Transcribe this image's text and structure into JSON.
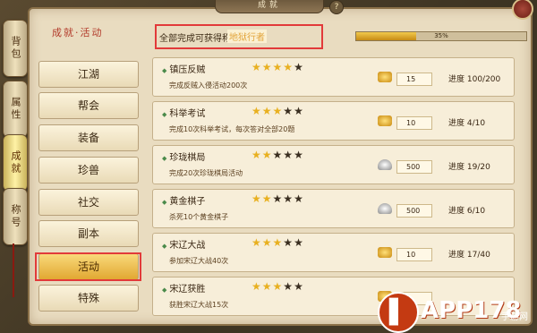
{
  "window": {
    "title": "成就",
    "help": "?"
  },
  "side_tabs": [
    {
      "label": "背包"
    },
    {
      "label": "属性"
    },
    {
      "label": "成就"
    },
    {
      "label": "称号"
    }
  ],
  "heading": "成就·活动",
  "reward": {
    "prefix": "全部完成可获得称号：",
    "title": "地狱行者"
  },
  "overall_progress": {
    "text": "35%",
    "value": 0.35
  },
  "categories": [
    {
      "label": "江湖"
    },
    {
      "label": "帮会"
    },
    {
      "label": "装备"
    },
    {
      "label": "珍兽"
    },
    {
      "label": "社交"
    },
    {
      "label": "副本"
    },
    {
      "label": "活动"
    },
    {
      "label": "特殊"
    }
  ],
  "achievements": [
    {
      "name": "镇压反贼",
      "desc": "完成反贼入侵活动200次",
      "stars": 4,
      "reward_type": "gold-ingot-icon",
      "reward": "15",
      "progress": "进度 100/200"
    },
    {
      "name": "科举考试",
      "desc": "完成10次科举考试，每次答对全部20题",
      "stars": 3,
      "reward_type": "gold-ingot-icon",
      "reward": "10",
      "progress": "进度 4/10"
    },
    {
      "name": "珍珑棋局",
      "desc": "完成20次珍珑棋局活动",
      "stars": 2,
      "reward_type": "silver-ingot-icon",
      "reward": "500",
      "progress": "进度 19/20"
    },
    {
      "name": "黄金棋子",
      "desc": "杀死10个黄金棋子",
      "stars": 2,
      "reward_type": "silver-ingot-icon",
      "reward": "500",
      "progress": "进度 6/10"
    },
    {
      "name": "宋辽大战",
      "desc": "参加宋辽大战40次",
      "stars": 3,
      "reward_type": "gold-ingot-icon",
      "reward": "10",
      "progress": "进度 17/40"
    },
    {
      "name": "宋辽获胜",
      "desc": "获胜宋辽大战15次",
      "stars": 3,
      "reward_type": "gold-ingot-icon",
      "reward": "",
      "progress": ""
    }
  ],
  "watermark": {
    "text": "APP178",
    "sub": "手游网"
  }
}
